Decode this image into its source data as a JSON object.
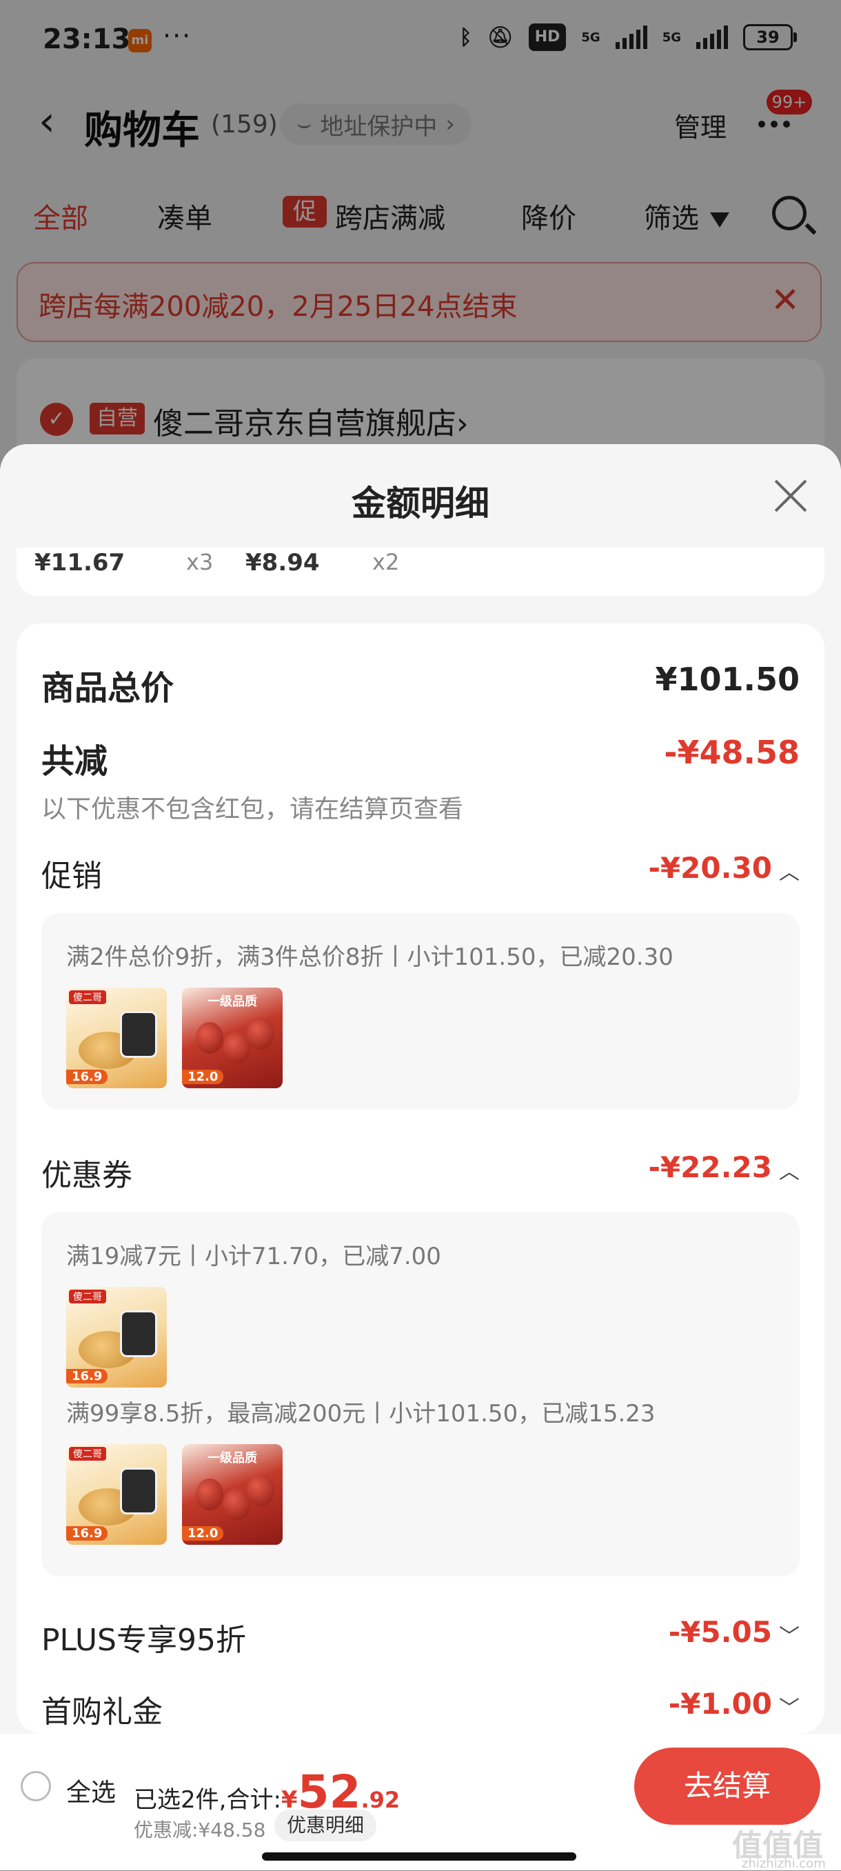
{
  "status": {
    "time": "23:13",
    "mi_label": "mi",
    "dots": "···",
    "hd": "HD",
    "network": "5G",
    "battery": "39"
  },
  "nav": {
    "back": "‹",
    "title": "购物车",
    "count": "(159)",
    "address": "地址保护中",
    "address_arrow": "›",
    "manage": "管理",
    "badge": "99+"
  },
  "tabs": {
    "all": "全部",
    "combine": "凑单",
    "promo_tag": "促",
    "cross_store": "跨店满减",
    "price_drop": "降价",
    "filter": "筛选"
  },
  "banner": {
    "text": "跨店每满200减20，2月25日24点结束",
    "close": "✕"
  },
  "store": {
    "check": "✓",
    "tag": "自营",
    "name": "傻二哥京东自营旗舰店",
    "arrow": "›"
  },
  "sheet": {
    "title": "金额明细",
    "peek": [
      {
        "price": "¥11.67",
        "qty": "x3"
      },
      {
        "price": "¥8.94",
        "qty": "x2"
      }
    ],
    "total_label": "商品总价",
    "total_value": "¥101.50",
    "reduce_label": "共减",
    "reduce_value": "-¥48.58",
    "reduce_note": "以下优惠不包含红包，请在结算页查看",
    "promo_label": "促销",
    "promo_value": "-¥20.30",
    "promo_detail": "满2件总价9折，满3件总价8折丨小计101.50，已减20.30",
    "coupon_label": "优惠券",
    "coupon_value": "-¥22.23",
    "coupon_detail_1": "满19减7元丨小计71.70，已减7.00",
    "coupon_detail_2": "满99享8.5折，最高减200元丨小计101.50，已减15.23",
    "plus_label": "PLUS专享95折",
    "plus_value": "-¥5.05",
    "first_label": "首购礼金",
    "first_value": "-¥1.00",
    "chev_up": "︿",
    "chev_down": "﹀"
  },
  "thumbs": {
    "peanut_badge": "傻二哥",
    "peanut_price": "16.9",
    "jujube_banner": "一级品质",
    "jujube_price": "12.0"
  },
  "bottom": {
    "select_all": "全选",
    "selected_prefix": "已选2件,合计:",
    "currency": "¥",
    "total_int": "52",
    "total_dec": ".92",
    "discount": "优惠减:¥48.58",
    "detail_btn": "优惠明细",
    "checkout": "去结算",
    "watermark": "值值值",
    "watermark_sub": "zhizhizhi.com"
  },
  "colors": {
    "accent": "#e03a2e",
    "checkout": "#e8493e"
  }
}
